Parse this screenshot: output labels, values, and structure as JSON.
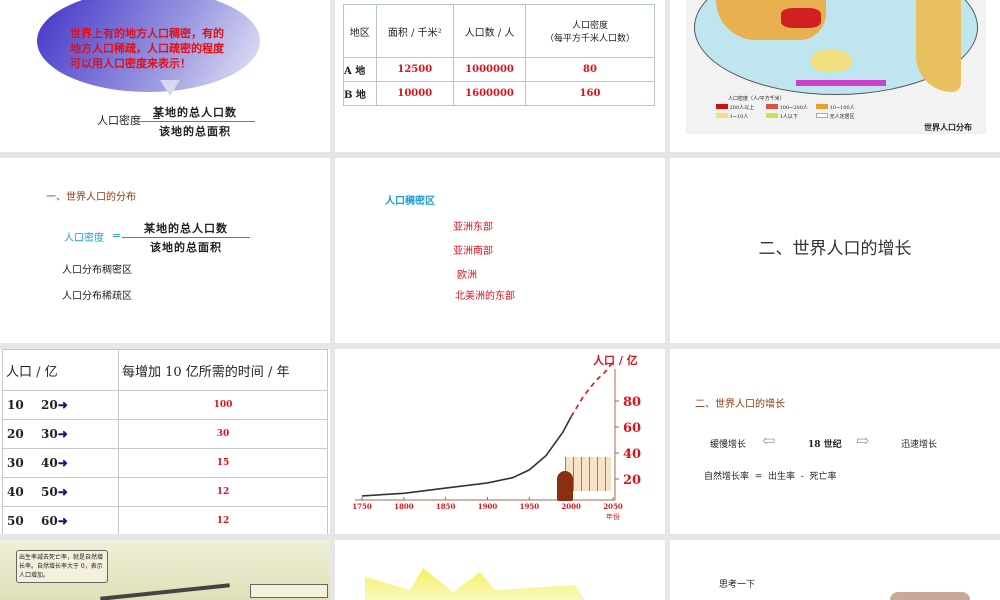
{
  "slides": {
    "s1": {
      "bubble": "世界上有的地方人口稠密，有的地方人口稀疏，人口疏密的程度可以用人口密度来表示！",
      "label": "人口密度",
      "eq": "=",
      "numerator": "某地的总人口数",
      "denominator": "该地的总面积"
    },
    "s2": {
      "headers": [
        "地区",
        "面积 / 千米²",
        "人口数 / 人",
        "人口密度",
        "（每平方千米人口数）"
      ],
      "rows": [
        [
          "A 地",
          "12500",
          "1000000",
          "80"
        ],
        [
          "B 地",
          "10000",
          "1600000",
          "160"
        ]
      ]
    },
    "s3": {
      "caption": "世界人口分布",
      "legend_title": "人口密度（人/平方千米）",
      "legend": [
        {
          "label": "200人以上",
          "color": "#d01010"
        },
        {
          "label": "100~200人",
          "color": "#e05040"
        },
        {
          "label": "10~100人",
          "color": "#e8a030"
        },
        {
          "label": "1~10人",
          "color": "#f0e080"
        },
        {
          "label": "1人以下",
          "color": "#c8e060"
        },
        {
          "label": "无人定居区",
          "color": "#ffffff"
        }
      ]
    },
    "s4": {
      "title": "一、世界人口的分布",
      "label": "人口密度",
      "eq": "=",
      "numerator": "某地的总人口数",
      "denominator": "该地的总面积",
      "item1": "人口分布稠密区",
      "item2": "人口分布稀疏区"
    },
    "s5": {
      "title": "人口稠密区",
      "items": [
        "亚洲东部",
        "亚洲南部",
        "欧洲",
        "北美洲的东部"
      ]
    },
    "s6": {
      "title": "二、世界人口的增长"
    },
    "s7": {
      "header1": "人口 / 亿",
      "header2": "每增加 10 亿所需的时间 / 年",
      "rows": [
        [
          "10",
          "20",
          "100"
        ],
        [
          "20",
          "30",
          "30"
        ],
        [
          "30",
          "40",
          "15"
        ],
        [
          "40",
          "50",
          "12"
        ],
        [
          "50",
          "60",
          "12"
        ]
      ]
    },
    "s9": {
      "title": "二、世界人口的增长",
      "left": "缓慢增长",
      "center": "18 世纪",
      "right": "迅速增长",
      "formula": "自然增长率  =  出生率  -  死亡率"
    },
    "s10": {
      "text": "出生率减去死亡率，就是自然增长率。自然增长率大于 0，表示人口增加。"
    },
    "s12": {
      "text": "思考一下"
    }
  },
  "chart_data": {
    "type": "line",
    "ylabel": "人口 / 亿",
    "xlabel": "年份",
    "xticks": [
      "1750",
      "1800",
      "1850",
      "1900",
      "1950",
      "2000",
      "2050"
    ],
    "yticks": [
      "20",
      "40",
      "60",
      "80"
    ],
    "xlim": [
      1750,
      2050
    ],
    "ylim": [
      0,
      110
    ],
    "series": [
      {
        "name": "actual",
        "style": "solid",
        "x": [
          1750,
          1800,
          1850,
          1900,
          1930,
          1950,
          1970,
          1990,
          2000
        ],
        "y": [
          7,
          9,
          13,
          17,
          21,
          27,
          38,
          56,
          68
        ]
      },
      {
        "name": "projection",
        "style": "dashed",
        "x": [
          2000,
          2015,
          2030,
          2040,
          2050
        ],
        "y": [
          68,
          84,
          96,
          102,
          110
        ]
      }
    ]
  },
  "colors": {
    "red": "#e0101a",
    "axis": "#a06a50"
  }
}
